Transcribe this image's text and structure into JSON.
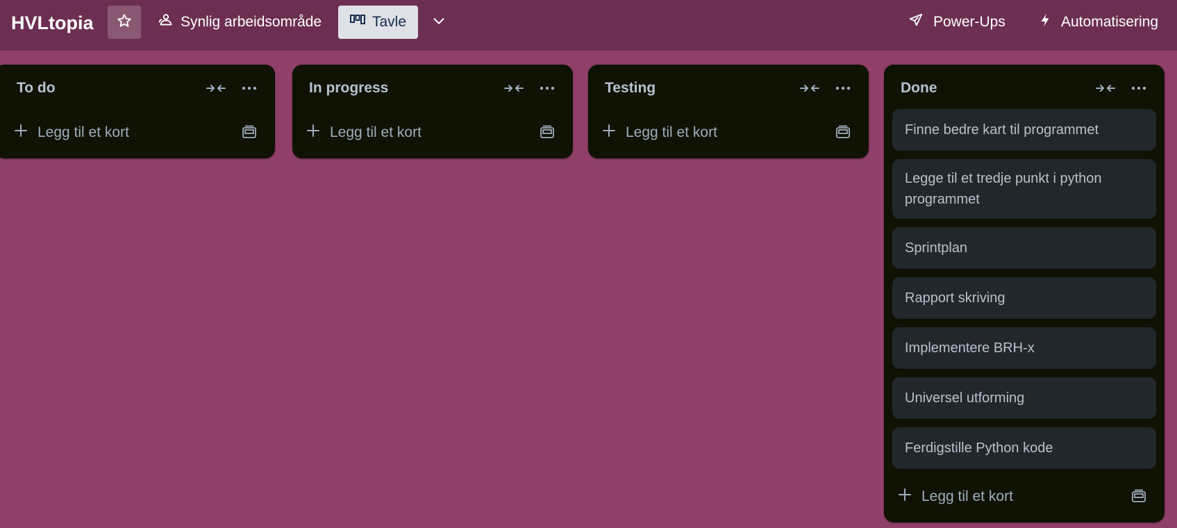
{
  "header": {
    "board_title": "HVLtopia",
    "visibility_label": "Synlig arbeidsområde",
    "view_label": "Tavle",
    "powerups_label": "Power-Ups",
    "automation_label": "Automatisering"
  },
  "lists": [
    {
      "title": "To do",
      "cards": [],
      "add_label": "Legg til et kort"
    },
    {
      "title": "In progress",
      "cards": [],
      "add_label": "Legg til et kort"
    },
    {
      "title": "Testing",
      "cards": [],
      "add_label": "Legg til et kort"
    },
    {
      "title": "Done",
      "cards": [
        "Finne bedre kart til programmet",
        "Legge til et tredje punkt i python programmet",
        "Sprintplan",
        "Rapport skriving",
        "Implementere BRH-x",
        "Universel utforming",
        "Ferdigstille Python kode"
      ],
      "add_label": "Legg til et kort"
    }
  ],
  "colors": {
    "board_background": "#8f3f68",
    "header_background": "#6c2f51",
    "list_background": "#101204",
    "card_background": "#22272b"
  },
  "icons": {
    "star": "star-icon",
    "visibility": "users-icon",
    "view": "board-icon",
    "chevron": "chevron-down-icon",
    "powerups": "rocket-icon",
    "automation": "lightning-icon",
    "collapse": "collapse-arrows-icon",
    "more": "more-icon",
    "add": "plus-icon",
    "template": "template-icon"
  }
}
